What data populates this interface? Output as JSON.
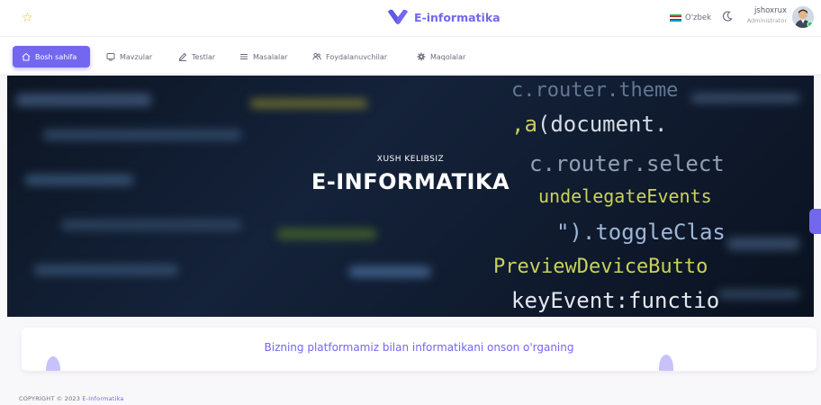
{
  "header": {
    "brand": "E-informatika",
    "language": "O'zbek",
    "user_name": "jshoxrux",
    "user_role": "Administrator"
  },
  "nav": {
    "items": [
      {
        "label": "Bosh sahifa",
        "icon": "home-icon",
        "active": true
      },
      {
        "label": "Mavzular",
        "icon": "monitor-icon"
      },
      {
        "label": "Testlar",
        "icon": "pencil-icon"
      },
      {
        "label": "Masalalar",
        "icon": "list-icon"
      },
      {
        "label": "Foydalanuvchilar",
        "icon": "users-icon"
      },
      {
        "label": "Maqolalar",
        "icon": "gear-icon"
      }
    ]
  },
  "hero": {
    "subtitle": "XUSH KELIBSIZ",
    "title": "E-INFORMATIKA"
  },
  "banner": {
    "text": "Bizning platformamiz bilan informatikani onson o'rganing"
  },
  "footer": {
    "copyright": "COPYRIGHT © 2023",
    "link": "E-Informatika"
  },
  "colors": {
    "accent": "#7367f0",
    "star": "#f2b41e",
    "flag": [
      "#1eb53a",
      "#ffffff",
      "#0099b5"
    ]
  }
}
